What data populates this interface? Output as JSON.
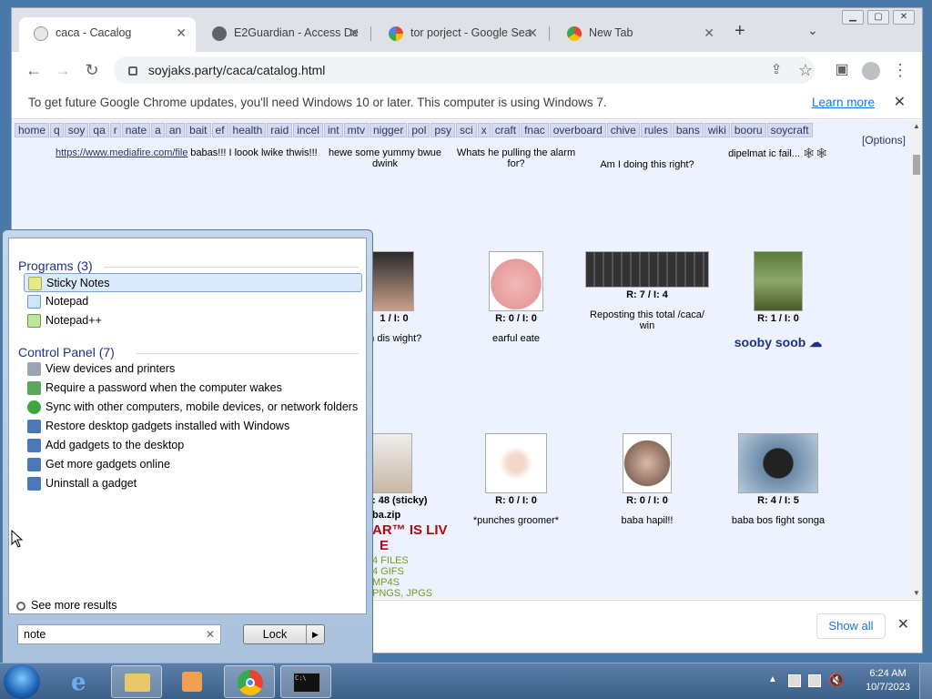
{
  "browser": {
    "tabs": [
      {
        "title": "caca - Cacalog",
        "active": true
      },
      {
        "title": "E2Guardian - Access De",
        "active": false
      },
      {
        "title": "tor porject - Google Sea",
        "active": false
      },
      {
        "title": "New Tab",
        "active": false
      }
    ],
    "url": "soyjaks.party/caca/catalog.html",
    "infobar": {
      "message": "To get future Google Chrome updates, you'll need Windows 10 or later. This computer is using Windows 7.",
      "link": "Learn more"
    },
    "download_bar": {
      "show_all": "Show all"
    }
  },
  "page": {
    "boards": [
      "home",
      "q",
      "soy",
      "qa",
      "r",
      "nate",
      "a",
      "an",
      "bait",
      "ef",
      "health",
      "raid",
      "incel",
      "int",
      "mtv",
      "nigger",
      "pol",
      "psy",
      "sci",
      "x",
      "craft",
      "fnac",
      "overboard",
      "chive",
      "rules",
      "bans",
      "wiki",
      "booru",
      "soycraft"
    ],
    "options": "[Options]",
    "top_row": [
      {
        "text": "https://www.mediafire.com/file"
      },
      {
        "text": "babas!!! I loook lwike thwis!!!"
      },
      {
        "text": "hewe some yummy bwue dwink"
      },
      {
        "text": "Whats he pulling the alarm for?"
      },
      {
        "text": "Am I doing this right?"
      },
      {
        "text": "dipelmat ic fail... 🕸🕸"
      }
    ],
    "middle_row": [
      {
        "stats": "1 / I: 0",
        "text": "in dis wight?"
      },
      {
        "stats": "R: 0 / I: 0",
        "text": "earful eate"
      },
      {
        "stats": "R: 7 / I: 4",
        "text": "Reposting this total /caca/ win"
      },
      {
        "stats": "R: 1 / I: 0",
        "text": "sooby soob ☁"
      }
    ],
    "bottom_row": [
      {
        "stats": ": 48 (sticky)",
        "text": "ba.zip",
        "extra": [
          "AR™ IS LIV",
          "E",
          "4 FILES",
          "4 GIFS",
          "MP4S",
          "PNGS, JPGS"
        ]
      },
      {
        "stats": "R: 0 / I: 0",
        "text": "*punches groomer*"
      },
      {
        "stats": "R: 0 / I: 0",
        "text": "baba hapil!!"
      },
      {
        "stats": "R: 4 / I: 5",
        "text": "baba bos fight songa"
      }
    ]
  },
  "start_menu": {
    "programs_header": "Programs (3)",
    "programs": [
      "Sticky Notes",
      "Notepad",
      "Notepad++"
    ],
    "control_header": "Control Panel (7)",
    "control_items": [
      "View devices and printers",
      "Require a password when the computer wakes",
      "Sync with other computers, mobile devices, or network folders",
      "Restore desktop gadgets installed with Windows",
      "Add gadgets to the desktop",
      "Get more gadgets online",
      "Uninstall a gadget"
    ],
    "see_more": "See more results",
    "search_value": "note",
    "lock_label": "Lock"
  },
  "taskbar": {
    "time": "6:24 AM",
    "date": "10/7/2023"
  },
  "colors": {
    "accent": "#1a73e8",
    "board_text": "#34345c",
    "start_header": "#1e3287"
  }
}
